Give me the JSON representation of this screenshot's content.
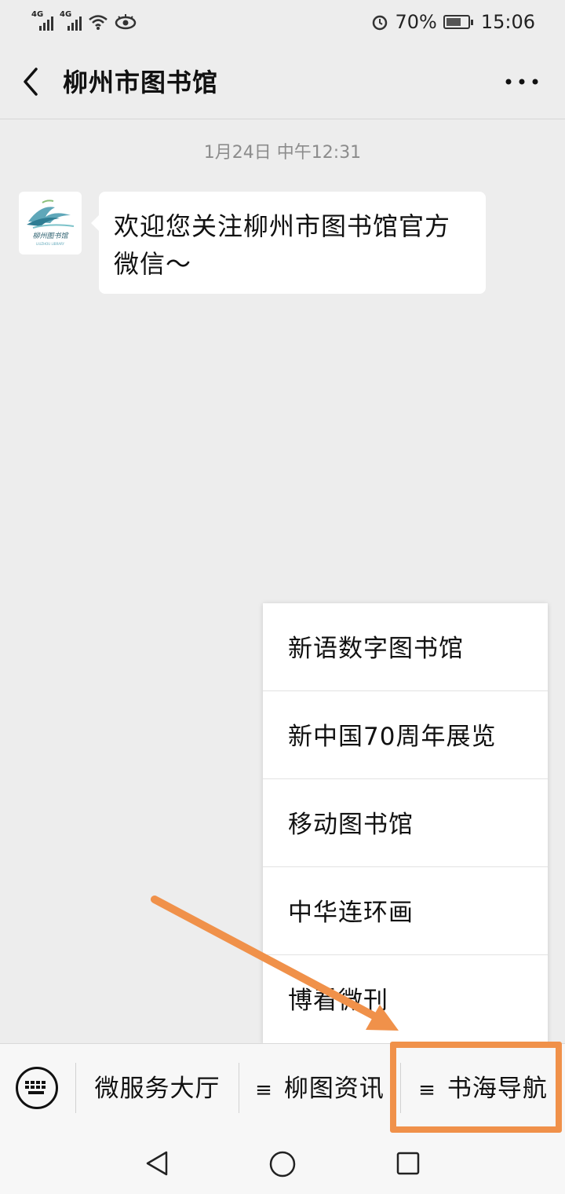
{
  "status_bar": {
    "net1": "4G",
    "net2": "4G",
    "battery_percent": "70%",
    "battery_level": 0.7,
    "time": "15:06",
    "icons": [
      "signal-icon",
      "wifi-icon",
      "eye-icon",
      "alarm-icon",
      "battery-icon"
    ]
  },
  "nav": {
    "title": "柳州市图书馆",
    "back_icon": "chevron-left-icon",
    "more_icon": "more-dots-icon"
  },
  "chat": {
    "timestamp": "1月24日 中午12:31",
    "message": "欢迎您关注柳州市图书馆官方微信～",
    "avatar_text": "柳州图书馆",
    "avatar_subtext": "LIUZHOU LIBRARY"
  },
  "popup_menu": {
    "items": [
      {
        "label": "新语数字图书馆"
      },
      {
        "label": "新中国70周年展览"
      },
      {
        "label": "移动图书馆"
      },
      {
        "label": "中华连环画"
      },
      {
        "label": "博看微刊"
      }
    ]
  },
  "bottom_menu": {
    "keyboard_icon": "keyboard-icon",
    "tabs": [
      {
        "label": "微服务大厅",
        "prefix": ""
      },
      {
        "label": "柳图资讯",
        "prefix": "≡"
      },
      {
        "label": "书海导航",
        "prefix": "≡"
      }
    ]
  },
  "annotation": {
    "color": "#f0914a"
  },
  "system_nav": {
    "icons": [
      "back-triangle-icon",
      "home-circle-icon",
      "recents-square-icon"
    ]
  }
}
